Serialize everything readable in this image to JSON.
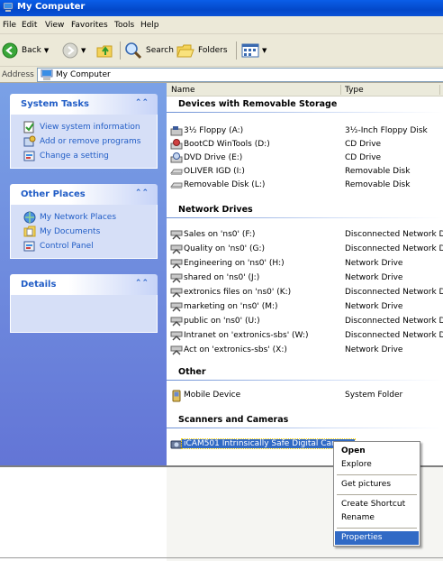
{
  "window": {
    "title": "My Computer"
  },
  "menubar": {
    "items": [
      "File",
      "Edit",
      "View",
      "Favorites",
      "Tools",
      "Help"
    ]
  },
  "toolbar": {
    "back_label": "Back",
    "search_label": "Search",
    "folders_label": "Folders"
  },
  "address": {
    "label": "Address",
    "value": "My Computer"
  },
  "left_panes": {
    "system_tasks": {
      "title": "System Tasks",
      "items": [
        "View system information",
        "Add or remove programs",
        "Change a setting"
      ]
    },
    "other_places": {
      "title": "Other Places",
      "items": [
        "My Network Places",
        "My Documents",
        "Control Panel"
      ]
    },
    "details": {
      "title": "Details"
    }
  },
  "columns": {
    "name": "Name",
    "type": "Type"
  },
  "groups": [
    {
      "title": "Devices with Removable Storage",
      "items": [
        {
          "name": "3½ Floppy (A:)",
          "type": "3½-Inch Floppy Disk",
          "icon": "floppy-drive-icon"
        },
        {
          "name": "BootCD WinTools (D:)",
          "type": "CD Drive",
          "icon": "cd-drive-icon"
        },
        {
          "name": "DVD Drive (E:)",
          "type": "CD Drive",
          "icon": "dvd-drive-icon"
        },
        {
          "name": "OLIVER IGD (I:)",
          "type": "Removable Disk",
          "icon": "removable-disk-icon"
        },
        {
          "name": "Removable Disk (L:)",
          "type": "Removable Disk",
          "icon": "removable-disk-icon"
        }
      ]
    },
    {
      "title": "Network Drives",
      "items": [
        {
          "name": "Sales on 'ns0' (F:)",
          "type": "Disconnected Network Drive",
          "icon": "network-drive-icon"
        },
        {
          "name": "Quality on 'ns0' (G:)",
          "type": "Disconnected Network Drive",
          "icon": "network-drive-icon"
        },
        {
          "name": "Engineering on 'ns0' (H:)",
          "type": "Network Drive",
          "icon": "network-drive-icon"
        },
        {
          "name": "shared on 'ns0' (J:)",
          "type": "Network Drive",
          "icon": "network-drive-icon"
        },
        {
          "name": "extronics files on 'ns0' (K:)",
          "type": "Disconnected Network Drive",
          "icon": "network-drive-icon"
        },
        {
          "name": "marketing on 'ns0' (M:)",
          "type": "Network Drive",
          "icon": "network-drive-icon"
        },
        {
          "name": "public on 'ns0' (U:)",
          "type": "Disconnected Network Drive",
          "icon": "network-drive-icon"
        },
        {
          "name": "Intranet on 'extronics-sbs' (W:)",
          "type": "Disconnected Network Drive",
          "icon": "network-drive-icon"
        },
        {
          "name": "Act on 'extronics-sbs' (X:)",
          "type": "Network Drive",
          "icon": "network-drive-icon"
        }
      ]
    },
    {
      "title": "Other",
      "items": [
        {
          "name": "Mobile Device",
          "type": "System Folder",
          "icon": "mobile-device-icon"
        }
      ]
    },
    {
      "title": "Scanners and Cameras",
      "items": [
        {
          "name": "iCAM501 Intrinsically Safe Digital Camera",
          "type": "",
          "icon": "camera-icon",
          "selected": true
        }
      ]
    }
  ],
  "context_menu": {
    "items": [
      "Open",
      "Explore",
      "Get pictures",
      "Create Shortcut",
      "Rename",
      "Properties"
    ],
    "bold": "Open",
    "highlighted": "Properties"
  },
  "colors": {
    "title_bar": "#0a52d6",
    "task_pane_bg": "#6b8ee0",
    "link_blue": "#215dc6",
    "selection": "#316ac5"
  }
}
